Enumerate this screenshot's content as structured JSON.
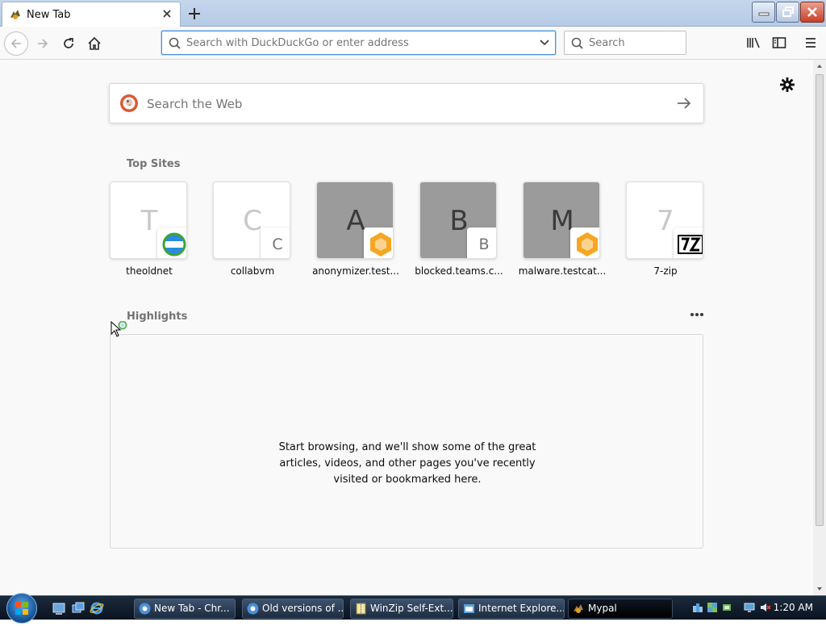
{
  "tab": {
    "title": "New Tab"
  },
  "window_controls": {
    "minimize": "minimize",
    "restore": "restore",
    "close": "close"
  },
  "navbar": {
    "url_placeholder": "Search with DuckDuckGo or enter address",
    "search_placeholder": "Search"
  },
  "newtab": {
    "websearch_placeholder": "Search the Web",
    "top_sites_title": "Top Sites",
    "top_sites": [
      {
        "label": "theoldnet",
        "letter": "T",
        "style": "light",
        "badge": "theoldnet-logo"
      },
      {
        "label": "collabvm",
        "letter": "C",
        "style": "light",
        "badge": "C"
      },
      {
        "label": "anonymizer.test...",
        "letter": "A",
        "style": "gray",
        "badge": "hexagon-logo"
      },
      {
        "label": "blocked.teams.c...",
        "letter": "B",
        "style": "gray",
        "badge": "B"
      },
      {
        "label": "malware.testcat...",
        "letter": "M",
        "style": "gray",
        "badge": "hexagon-logo"
      },
      {
        "label": "7-zip",
        "letter": "7",
        "style": "light",
        "badge": "7z-logo"
      }
    ],
    "highlights_title": "Highlights",
    "highlights_empty": "Start browsing, and we'll show some of the great articles, videos, and other pages you've recently visited or bookmarked here."
  },
  "taskbar": {
    "tasks": [
      {
        "label": "New Tab - Chr..."
      },
      {
        "label": "Old versions of ..."
      },
      {
        "label": "WinZip Self-Ext..."
      },
      {
        "label": "Internet Explore..."
      },
      {
        "label": "Mypal"
      }
    ],
    "clock": "1:20 AM"
  }
}
